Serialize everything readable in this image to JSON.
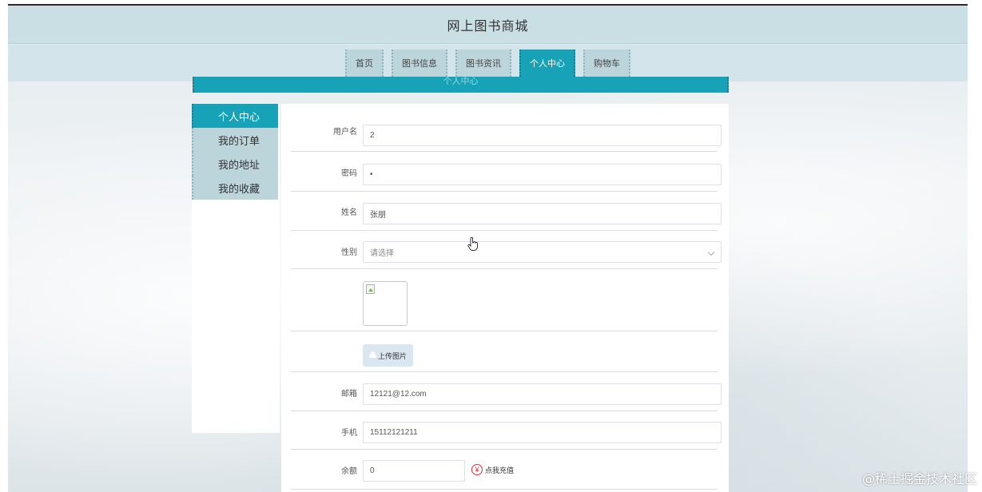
{
  "header": {
    "title": "网上图书商城"
  },
  "nav": {
    "items": [
      {
        "label": "首页"
      },
      {
        "label": "图书信息"
      },
      {
        "label": "图书资讯"
      },
      {
        "label": "个人中心"
      },
      {
        "label": "购物车"
      }
    ],
    "active": "个人中心"
  },
  "section": {
    "title": "个人中心"
  },
  "sidebar": {
    "items": [
      {
        "label": "个人中心"
      },
      {
        "label": "我的订单"
      },
      {
        "label": "我的地址"
      },
      {
        "label": "我的收藏"
      }
    ]
  },
  "form": {
    "username": {
      "label": "用户名",
      "value": "2"
    },
    "password": {
      "label": "密码",
      "value": "•"
    },
    "name": {
      "label": "姓名",
      "value": "张朋"
    },
    "gender": {
      "label": "性别",
      "placeholder": "请选择"
    },
    "upload": {
      "label": "上传图片"
    },
    "email": {
      "label": "邮箱",
      "value": "12121@12.com"
    },
    "phone": {
      "label": "手机",
      "value": "15112121211"
    },
    "balance": {
      "label": "余额",
      "value": "0",
      "recharge": "点我充值"
    }
  },
  "colors": {
    "accent": "#17a2b8",
    "nav_bg": "#bcd5db",
    "header_bg": "#c9dfe4"
  },
  "watermark": "@稀土掘金技术社区"
}
